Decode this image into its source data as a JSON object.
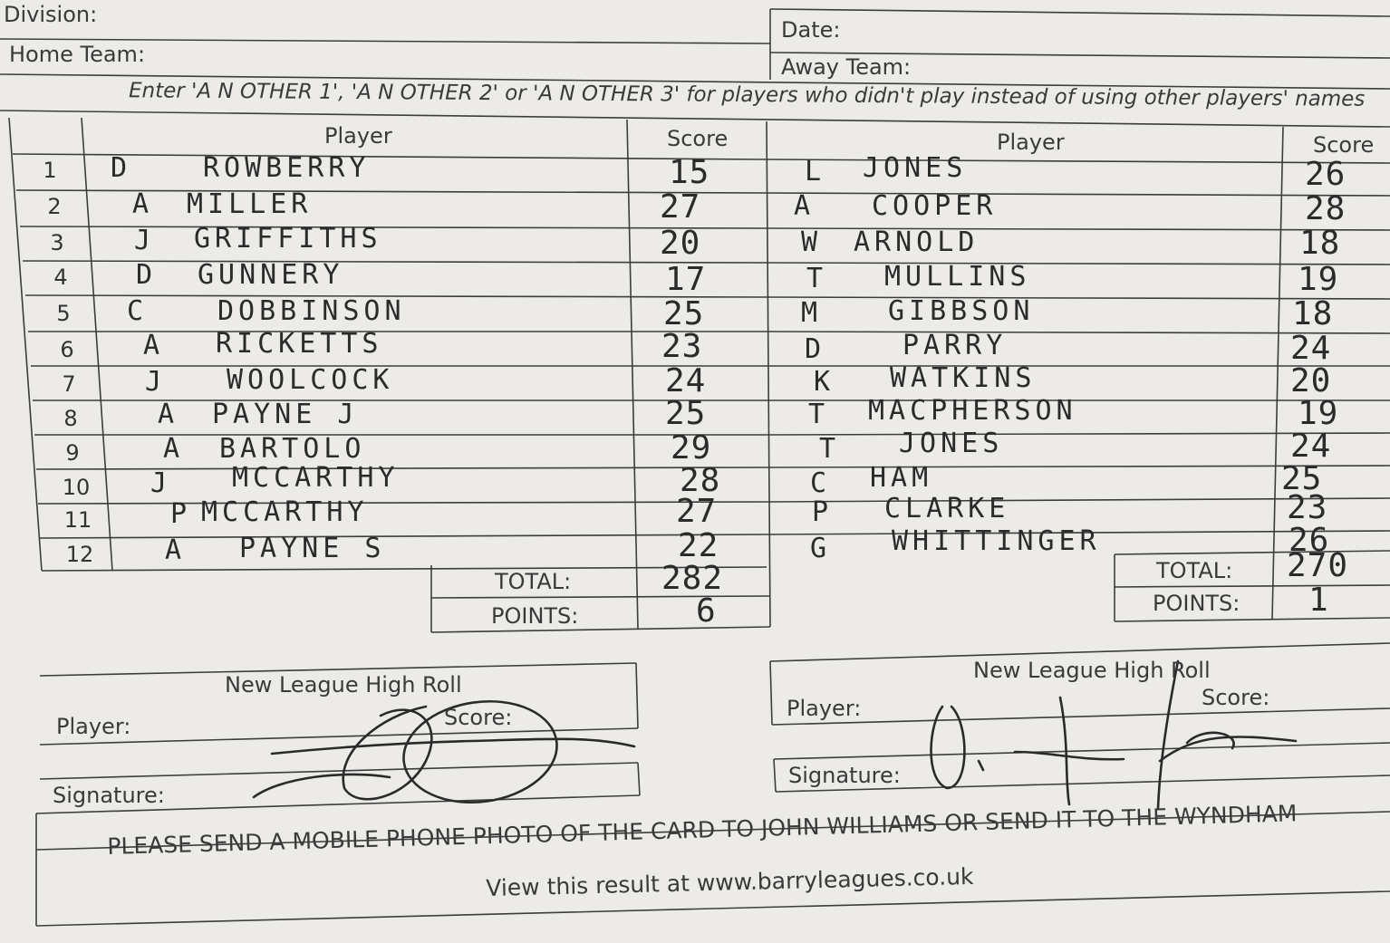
{
  "header": {
    "division_label": "Division:",
    "date_label": "Date:",
    "home_team_label": "Home Team:",
    "away_team_label": "Away Team:",
    "instruction": "Enter 'A N OTHER 1', 'A N OTHER 2' or 'A N OTHER 3' for players who didn't play instead of using other players' names"
  },
  "columns": {
    "home_player": "Player",
    "home_score": "Score",
    "away_player": "Player",
    "away_score": "Score"
  },
  "rows": [
    {
      "n": "1",
      "hi": "D",
      "hn": "ROWBERRY",
      "hs": "15",
      "ai": "L",
      "an": "JONES",
      "as": "26"
    },
    {
      "n": "2",
      "hi": "A",
      "hn": "MILLER",
      "hs": "27",
      "ai": "A",
      "an": "COOPER",
      "as": "28"
    },
    {
      "n": "3",
      "hi": "J",
      "hn": "GRIFFITHS",
      "hs": "20",
      "ai": "W",
      "an": "ARNOLD",
      "as": "18"
    },
    {
      "n": "4",
      "hi": "D",
      "hn": "GUNNERY",
      "hs": "17",
      "ai": "T",
      "an": "MULLINS",
      "as": "19"
    },
    {
      "n": "5",
      "hi": "C",
      "hn": "DOBBINSON",
      "hs": "25",
      "ai": "M",
      "an": "GIBBSON",
      "as": "18"
    },
    {
      "n": "6",
      "hi": "A",
      "hn": "RICKETTS",
      "hs": "23",
      "ai": "D",
      "an": "PARRY",
      "as": "24"
    },
    {
      "n": "7",
      "hi": "J",
      "hn": "WOOLCOCK",
      "hs": "24",
      "ai": "K",
      "an": "WATKINS",
      "as": "20"
    },
    {
      "n": "8",
      "hi": "A",
      "hn": "PAYNE J",
      "hs": "25",
      "ai": "T",
      "an": "MACPHERSON",
      "as": "19"
    },
    {
      "n": "9",
      "hi": "A",
      "hn": "BARTOLO",
      "hs": "29",
      "ai": "T",
      "an": "JONES",
      "as": "24"
    },
    {
      "n": "10",
      "hi": "J",
      "hn": "MCCARTHY",
      "hs": "28",
      "ai": "C",
      "an": "HAM",
      "as": "25"
    },
    {
      "n": "11",
      "hi": "P",
      "hn": "MCCARTHY",
      "hs": "27",
      "ai": "P",
      "an": "CLARKE",
      "as": "23"
    },
    {
      "n": "12",
      "hi": "A",
      "hn": "PAYNE S",
      "hs": "22",
      "ai": "G",
      "an": "WHITTINGER",
      "as": "26"
    }
  ],
  "home_totals": {
    "total_label": "TOTAL:",
    "total": "282",
    "points_label": "POINTS:",
    "points": "6"
  },
  "away_totals": {
    "total_label": "TOTAL:",
    "total": "270",
    "points_label": "POINTS:",
    "points": "1"
  },
  "home_high_roll": {
    "title": "New League High Roll",
    "player_label": "Player:",
    "score_label": "Score:",
    "signature_label": "Signature:"
  },
  "away_high_roll": {
    "title": "New League High Roll",
    "player_label": "Player:",
    "score_label": "Score:",
    "signature_label": "Signature:"
  },
  "footer": {
    "line1": "PLEASE SEND A MOBILE PHONE PHOTO OF THE CARD TO JOHN WILLIAMS OR SEND IT TO THE WYNDHAM",
    "line2": "View this result at www.barryleagues.co.uk"
  }
}
